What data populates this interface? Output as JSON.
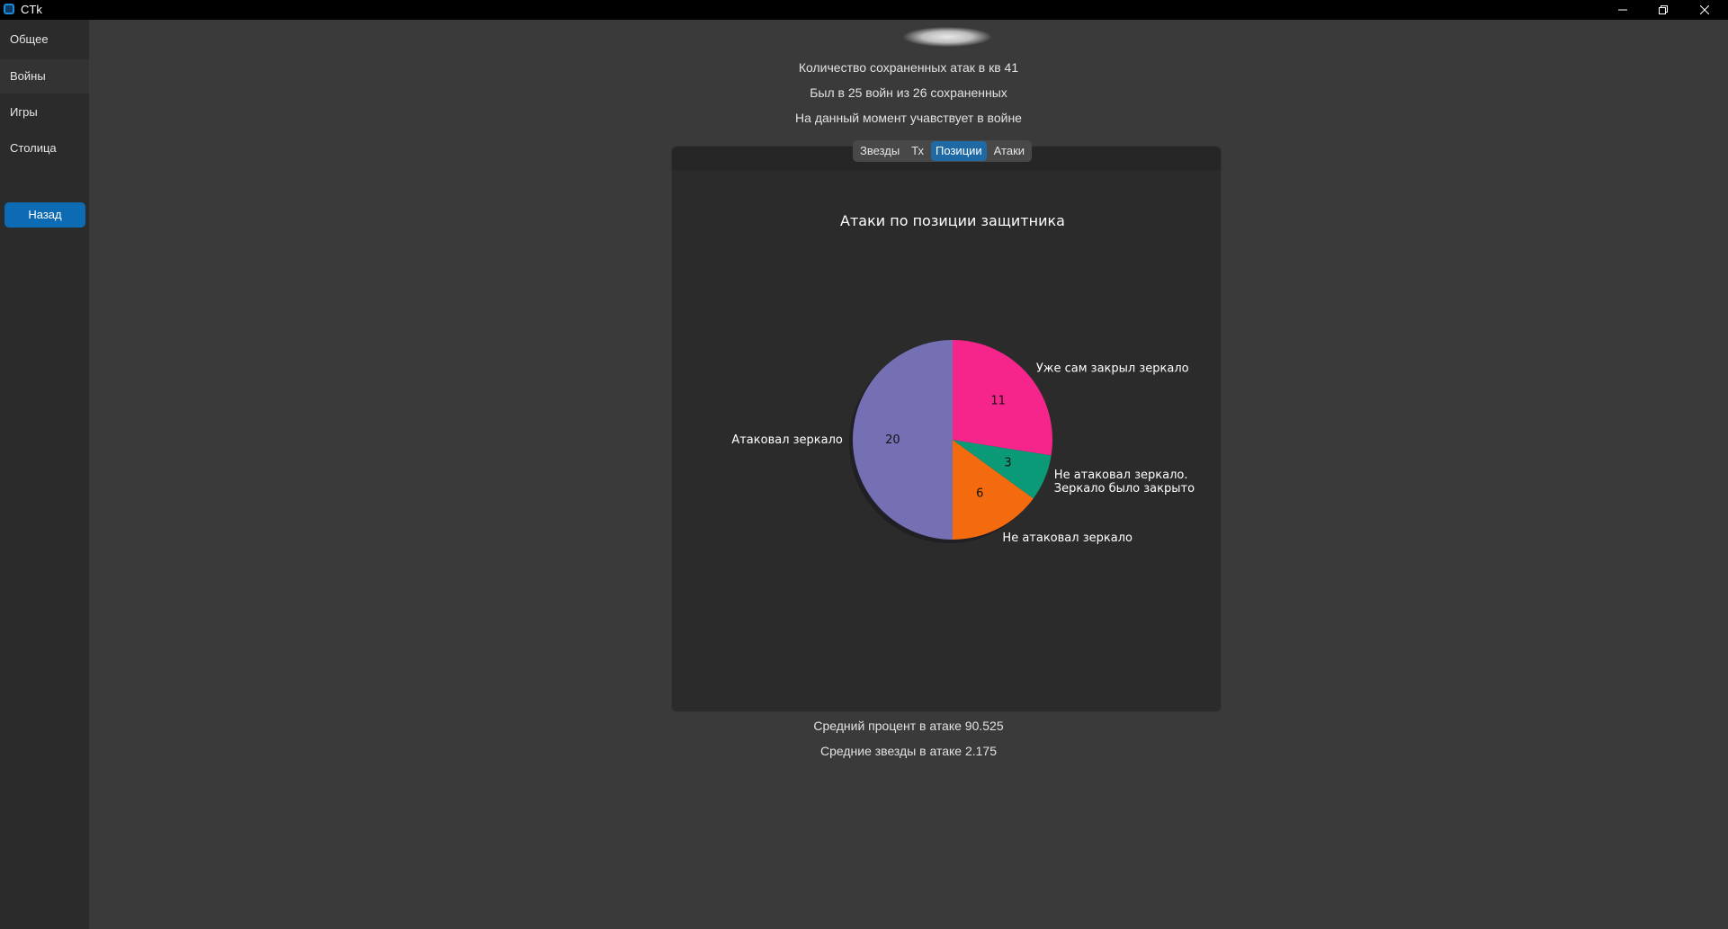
{
  "window": {
    "title": "CTk"
  },
  "sidebar": {
    "items": [
      {
        "label": "Общее"
      },
      {
        "label": "Войны"
      },
      {
        "label": "Игры"
      },
      {
        "label": "Столица"
      }
    ],
    "back_label": "Назад"
  },
  "summary": {
    "saved_attacks": "Количество сохраненных атак в кв 41",
    "wars": "Был в 25 войн из 26 сохраненных",
    "current_status": "На данный момент учавствует в войне",
    "avg_percent": "Средний процент в атаке 90.525",
    "avg_stars": "Средние звезды в атаке 2.175"
  },
  "tabs": [
    {
      "label": "Звезды",
      "active": false
    },
    {
      "label": "Тх",
      "active": false
    },
    {
      "label": "Позиции",
      "active": true
    },
    {
      "label": "Атаки",
      "active": false
    }
  ],
  "colors": {
    "accent": "#1f6aa5",
    "slice_colors": [
      "#7570b3",
      "#f46a0f",
      "#0b9a77",
      "#f5258b"
    ]
  },
  "chart_data": {
    "type": "pie",
    "title": "Атаки по позиции защитника",
    "slices": [
      {
        "label": "Атаковал зеркало",
        "value": 20
      },
      {
        "label": "Не атаковал зеркало",
        "value": 6
      },
      {
        "label": "Не атаковал зеркало.\nЗеркало было закрыто",
        "value": 3
      },
      {
        "label": "Уже сам закрыл зеркало",
        "value": 11
      }
    ],
    "start_angle_deg": 270,
    "direction": "counterclockwise",
    "shadow": true
  }
}
